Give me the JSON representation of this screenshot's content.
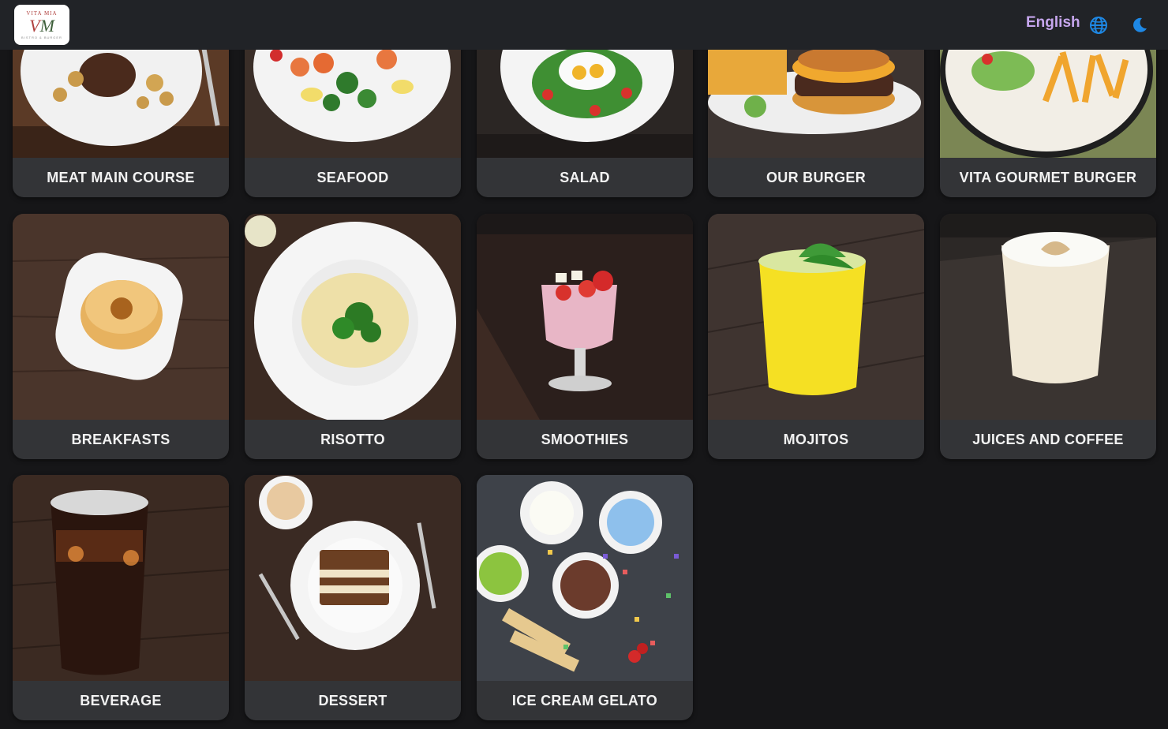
{
  "header": {
    "logo_top": "VITA MIA",
    "logo_mark_v": "V",
    "logo_mark_m": "M",
    "logo_sub": "BISTRO & BURGER",
    "language": "English"
  },
  "icons": [
    "globe-icon",
    "moon-icon"
  ],
  "colors": {
    "topbar": "#212327",
    "background": "#161618",
    "card": "#333437",
    "language_text": "#c6a6ee",
    "icon_blue": "#1e88e5"
  },
  "categories": [
    {
      "label": "MEAT MAIN COURSE"
    },
    {
      "label": "SEAFOOD"
    },
    {
      "label": "SALAD"
    },
    {
      "label": "OUR BURGER"
    },
    {
      "label": "VITA GOURMET BURGER"
    },
    {
      "label": "BREAKFASTS"
    },
    {
      "label": "RISOTTO"
    },
    {
      "label": "SMOOTHIES"
    },
    {
      "label": "MOJITOS"
    },
    {
      "label": "JUICES AND COFFEE"
    },
    {
      "label": "BEVERAGE"
    },
    {
      "label": "DESSERT"
    },
    {
      "label": "ICE CREAM GELATO"
    }
  ]
}
